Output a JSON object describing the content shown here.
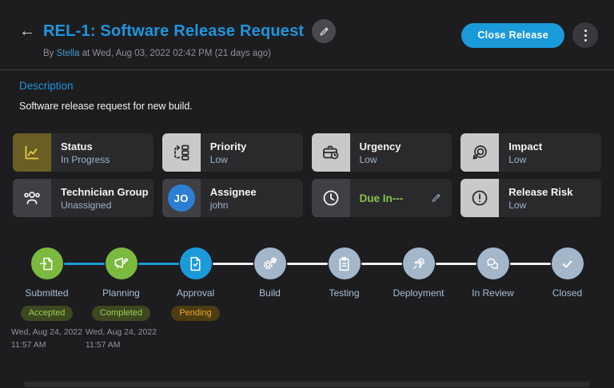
{
  "header": {
    "back_icon": "←",
    "title": "REL-1: Software Release Request",
    "byline_prefix": "By ",
    "author": "Stella",
    "byline_rest": " at Wed, Aug 03, 2022 02:42 PM (21 days ago)",
    "close_button": "Close Release"
  },
  "description": {
    "heading": "Description",
    "body": "Software release request for new build."
  },
  "cards": [
    {
      "title": "Status",
      "value": "In Progress",
      "icon": "chart-line-icon"
    },
    {
      "title": "Priority",
      "value": "Low",
      "icon": "workflow-icon"
    },
    {
      "title": "Urgency",
      "value": "Low",
      "icon": "briefcase-clock-icon"
    },
    {
      "title": "Impact",
      "value": "Low",
      "icon": "target-arrow-icon"
    },
    {
      "title": "Technician Group",
      "value": "Unassigned",
      "icon": "people-group-icon"
    },
    {
      "title": "Assignee",
      "value": "john",
      "icon": "avatar",
      "avatar_initials": "JO"
    },
    {
      "title": "Due In---",
      "value": "",
      "icon": "clock-icon",
      "editable": true
    },
    {
      "title": "Release Risk",
      "value": "Low",
      "icon": "alert-circle-icon"
    }
  ],
  "timeline": {
    "steps": [
      {
        "label": "Submitted",
        "state": "done",
        "badge": "Accepted",
        "date_line1": "Wed, Aug 24, 2022",
        "date_line2": "11:57 AM",
        "icon": "document-import-icon"
      },
      {
        "label": "Planning",
        "state": "done",
        "badge": "Completed",
        "date_line1": "Wed, Aug 24, 2022",
        "date_line2": "11:57 AM",
        "icon": "plan-edit-icon"
      },
      {
        "label": "Approval",
        "state": "current",
        "badge": "Pending",
        "icon": "document-check-icon"
      },
      {
        "label": "Build",
        "state": "todo",
        "icon": "gears-icon"
      },
      {
        "label": "Testing",
        "state": "todo",
        "icon": "clipboard-icon"
      },
      {
        "label": "Deployment",
        "state": "todo",
        "icon": "rocket-icon"
      },
      {
        "label": "In Review",
        "state": "todo",
        "icon": "chat-bubbles-icon"
      },
      {
        "label": "Closed",
        "state": "todo",
        "icon": "check-icon"
      }
    ]
  },
  "colors": {
    "page_bg": "#1d1d1f",
    "card_bg": "#2a2a2d",
    "accent_blue": "#1b9ada",
    "title_blue": "#1e95dd",
    "success_green": "#7cb93f",
    "inactive_step": "#a4b6ca",
    "pending_amber": "#eda62c",
    "due_green": "#8bc34a",
    "status_icon_yellow": "#ecc94b",
    "avatar_blue": "#2d7fd3"
  }
}
